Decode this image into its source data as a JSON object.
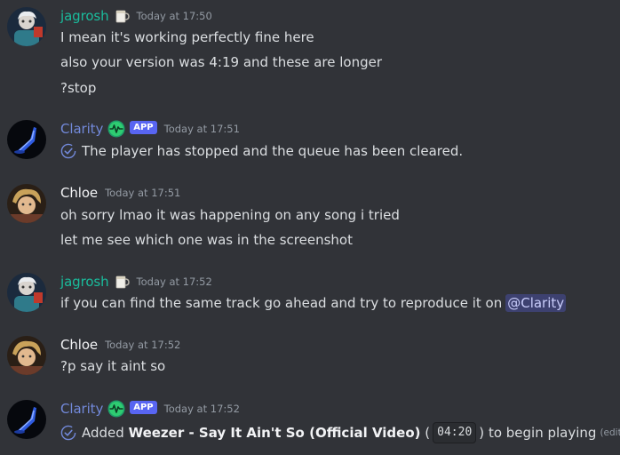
{
  "messages": [
    {
      "author": "jagrosh",
      "timestamp": "Today at 17:50",
      "lines": [
        "I mean it's working perfectly fine here",
        "also your version was 4:19 and these are longer",
        "?stop"
      ]
    },
    {
      "author": "Clarity",
      "badge": "APP",
      "timestamp": "Today at 17:51",
      "lines": [
        "The player has stopped and the queue has been cleared."
      ]
    },
    {
      "author": "Chloe",
      "timestamp": "Today at 17:51",
      "lines": [
        "oh sorry lmao it was happening on any song i tried",
        "let me see which one was in the screenshot"
      ]
    },
    {
      "author": "jagrosh",
      "timestamp": "Today at 17:52",
      "text_before_mention": "if you can find the same track go ahead and try to reproduce it on",
      "mention": "@Clarity"
    },
    {
      "author": "Chloe",
      "timestamp": "Today at 17:52",
      "lines": [
        "?p say it aint so"
      ]
    },
    {
      "author": "Clarity",
      "badge": "APP",
      "timestamp": "Today at 17:52",
      "added_prefix": "Added",
      "track": "Weezer - Say It Ain't So (Official Video)",
      "duration_open": "(",
      "duration": "04:20",
      "duration_close": ")",
      "added_suffix": "to begin playing",
      "edited": "(edited)"
    }
  ],
  "colors": {
    "background": "#313338",
    "jagrosh": "#1abc9c",
    "clarity": "#7289da",
    "chloe": "#f2f3f5",
    "timestamp": "#949ba4",
    "app_badge": "#5865f2"
  },
  "icons": [
    "mug-icon",
    "role-heartbeat-icon",
    "verified-check-icon"
  ]
}
